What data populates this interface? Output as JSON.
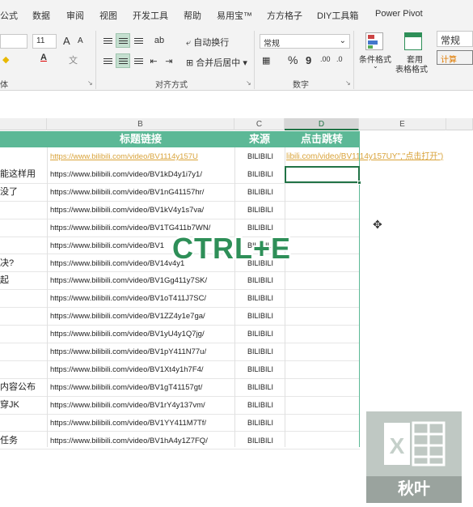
{
  "menu": [
    "公式",
    "数据",
    "审阅",
    "视图",
    "开发工具",
    "帮助",
    "易用宝™",
    "方方格子",
    "DIY工具箱",
    "Power Pivot"
  ],
  "ribbon": {
    "font_size": "11",
    "font_grow": "A",
    "font_shrink": "A",
    "font_group_label": "体",
    "wrap_text": "自动换行",
    "merge_center": "合并后居中",
    "align_group_label": "对齐方式",
    "number_format": "常规",
    "number_group_label": "数字",
    "percent": "%",
    "comma": "9",
    "cond_format": "条件格式",
    "table_format_line1": "套用",
    "table_format_line2": "表格格式",
    "style_normal": "常规",
    "style_calc": "计算"
  },
  "grid": {
    "column_headers": [
      "B",
      "C",
      "D",
      "E"
    ],
    "header_row": [
      "标题链接",
      "来源",
      "点击跳转"
    ],
    "first_row": {
      "link": "https://www.bilibili.com/video/BV1114y157U",
      "source": "BILIBILI",
      "formula": "libili.com/video/BV1114y157UY\",\"点击打开\")"
    },
    "rows": [
      {
        "title": "能这样用",
        "link": "https://www.bilibili.com/video/BV1kD4y1i7y1/",
        "source": "BILIBILI"
      },
      {
        "title": "没了",
        "link": "https://www.bilibili.com/video/BV1nG41157hr/",
        "source": "BILIBILI"
      },
      {
        "title": "",
        "link": "https://www.bilibili.com/video/BV1kV4y1s7va/",
        "source": "BILIBILI"
      },
      {
        "title": "",
        "link": "https://www.bilibili.com/video/BV1TG411b7WN/",
        "source": "BILIBILI"
      },
      {
        "title": "",
        "link": "https://www.bilibili.com/video/BV1",
        "source": "BILIBILI"
      },
      {
        "title": "决?",
        "link": "https://www.bilibili.com/video/BV14v4y1",
        "source": "BILIBILI"
      },
      {
        "title": "起",
        "link": "https://www.bilibili.com/video/BV1Gg411y7SK/",
        "source": "BILIBILI"
      },
      {
        "title": "",
        "link": "https://www.bilibili.com/video/BV1oT411J7SC/",
        "source": "BILIBILI"
      },
      {
        "title": "",
        "link": "https://www.bilibili.com/video/BV1ZZ4y1e7ga/",
        "source": "BILIBILI"
      },
      {
        "title": "",
        "link": "https://www.bilibili.com/video/BV1yU4y1Q7jg/",
        "source": "BILIBILI"
      },
      {
        "title": "",
        "link": "https://www.bilibili.com/video/BV1pY411N77u/",
        "source": "BILIBILI"
      },
      {
        "title": "",
        "link": "https://www.bilibili.com/video/BV1Xt4y1h7F4/",
        "source": "BILIBILI"
      },
      {
        "title": "内容公布",
        "link": "https://www.bilibili.com/video/BV1gT41157gt/",
        "source": "BILIBILI"
      },
      {
        "title": "穿JK",
        "link": "https://www.bilibili.com/video/BV1rY4y137vm/",
        "source": "BILIBILI"
      },
      {
        "title": "",
        "link": "https://www.bilibili.com/video/BV1YY411M7Tf/",
        "source": "BILIBILI"
      },
      {
        "title": "任务",
        "link": "https://www.bilibili.com/video/BV1hA4y1Z7FQ/",
        "source": "BILIBILI"
      }
    ]
  },
  "overlay_text": "CTRL+E",
  "logo_caption": "秋叶",
  "colors": {
    "accent": "#5cb896",
    "brand_green": "#217346",
    "link_orange": "#d9a33a"
  }
}
